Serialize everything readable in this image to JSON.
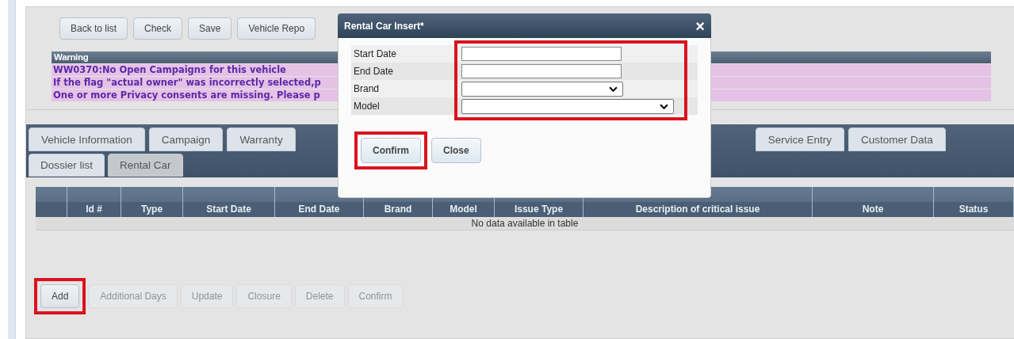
{
  "toolbar": [
    {
      "label": "Back to list"
    },
    {
      "label": "Check"
    },
    {
      "label": "Save"
    },
    {
      "label": "Vehicle Repo"
    }
  ],
  "warning": {
    "title": "Warning",
    "lines": [
      "WW0370:No Open Campaigns for this vehicle",
      "If the flag \"actual owner\" was incorrectly selected,p",
      "One or more Privacy consents are missing. Please p"
    ]
  },
  "tabs": [
    {
      "label": "Vehicle Information",
      "selected": false
    },
    {
      "label": "Campaign",
      "selected": false
    },
    {
      "label": "Warranty",
      "selected": false
    },
    {
      "label": "Service Entry",
      "selected": false
    },
    {
      "label": "Customer Data",
      "selected": false
    }
  ],
  "subtabs": [
    {
      "label": "Dossier list",
      "selected": false
    },
    {
      "label": "Rental Car",
      "selected": true
    }
  ],
  "table": {
    "columns": [
      "",
      "Id #",
      "Type",
      "Start Date",
      "End Date",
      "Brand",
      "Model",
      "Issue Type",
      "Description of critical issue",
      "Note",
      "Status"
    ],
    "empty": "No data available in table"
  },
  "actions": [
    {
      "label": "Add",
      "disabled": false,
      "highlighted": true
    },
    {
      "label": "Additional Days",
      "disabled": true,
      "highlighted": false
    },
    {
      "label": "Update",
      "disabled": true,
      "highlighted": false
    },
    {
      "label": "Closure",
      "disabled": true,
      "highlighted": false
    },
    {
      "label": "Delete",
      "disabled": true,
      "highlighted": false
    },
    {
      "label": "Confirm",
      "disabled": true,
      "highlighted": false
    }
  ],
  "dialog": {
    "title": "Rental Car Insert*",
    "close": "×",
    "fields_highlighted": true,
    "fields": [
      {
        "label": "Start Date",
        "kind": "text"
      },
      {
        "label": "End Date",
        "kind": "text"
      },
      {
        "label": "Brand",
        "kind": "select"
      },
      {
        "label": "Model",
        "kind": "select"
      }
    ],
    "buttons": [
      {
        "label": "Confirm",
        "highlighted": true
      },
      {
        "label": "Close",
        "highlighted": false
      }
    ]
  }
}
